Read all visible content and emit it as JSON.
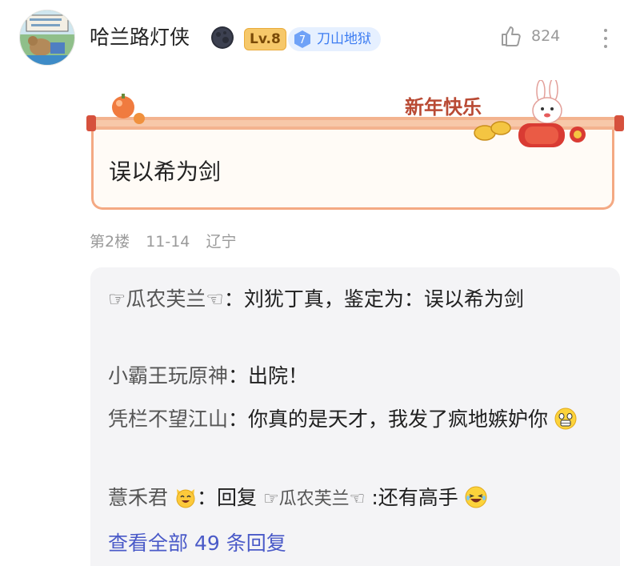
{
  "user": {
    "name": "哈兰路灯侠",
    "level": "Lv.8",
    "tag_number": "7",
    "tag_label": "刀山地狱"
  },
  "likes": "824",
  "post": {
    "banner_text": "新年快乐",
    "content": "误以希为剑",
    "floor": "第2楼",
    "date": "11-14",
    "location": "辽宁"
  },
  "replies": [
    {
      "name": "☞瓜农芙兰☜",
      "separator": "：",
      "text": "刘犹丁真，鉴定为：误以希为剑"
    },
    {
      "name": "小霸王玩原神",
      "separator": "：",
      "text": "出院！"
    },
    {
      "name": "凭栏不望江山",
      "separator": "：",
      "text": "你真的是天才，我发了疯地嫉妒你"
    },
    {
      "name": "薏禾君",
      "separator": "：",
      "reply_word": "回复",
      "reply_target": "☞瓜农芙兰☜",
      "text": ":还有高手"
    }
  ],
  "view_all": "查看全部 49 条回复",
  "colors": {
    "accent_blue": "#3d7df2",
    "link": "#4a5ac8",
    "card_border": "#f4a983",
    "badge_gold": "#f6c86a"
  },
  "icons": [
    "avatar",
    "moon-icon",
    "diamond-icon",
    "thumbs-up-icon",
    "more-icon",
    "rabbit-icon",
    "scream-emoji",
    "cat-emoji",
    "laugh-emoji"
  ]
}
